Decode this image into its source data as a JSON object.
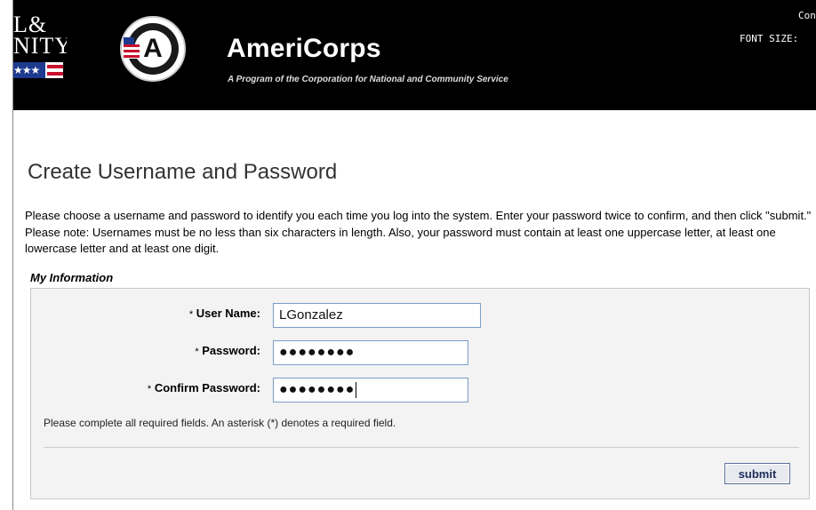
{
  "header": {
    "side_logo_text": "L&\nNITY",
    "seal_letter": "A",
    "brand_title": "AmeriCorps",
    "brand_subtitle": "A Program of the Corporation for National and Community Service",
    "contact_label": "Con",
    "font_size_label": "FONT SIZE:"
  },
  "page": {
    "title": "Create Username and Password",
    "intro": "Please choose a username and password to identify you each time you log into the system. Enter your password twice to confirm, and then click \"submit.\" Please note: Usernames must be no less than six characters in length. Also, your password must contain at least one uppercase letter, at least one lowercase letter and at least one digit."
  },
  "form": {
    "section_label": "My Information",
    "asterisk": "*",
    "username_label": "User Name:",
    "username_value": "LGonzalez",
    "password_label": "Password:",
    "password_value": "●●●●●●●●",
    "confirm_label": "Confirm Password:",
    "confirm_value": "●●●●●●●●",
    "required_note": "Please complete all required fields. An asterisk (*) denotes a required field.",
    "submit_label": "submit"
  },
  "colors": {
    "header_bg": "#000000",
    "panel_bg": "#f3f3f3",
    "input_border": "#7a9cc6",
    "button_border": "#5a6f9a"
  }
}
